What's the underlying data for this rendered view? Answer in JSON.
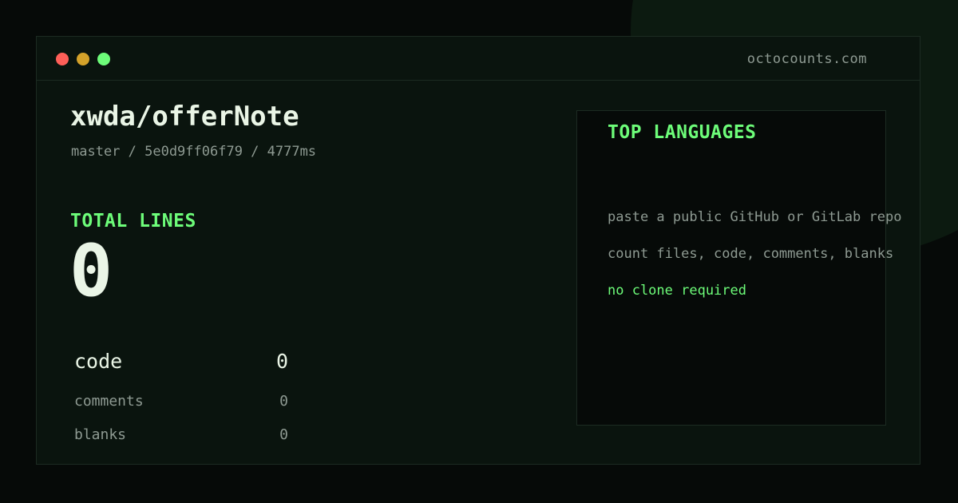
{
  "window": {
    "site": "octocounts.com",
    "controls": {
      "close_color": "#fe5f58",
      "minimize_color": "#d4a22a",
      "maximize_color": "#6dfc79"
    }
  },
  "repo": {
    "title": "xwda/offerNote",
    "meta": "master / 5e0d9ff06f79 / 4777ms"
  },
  "totals": {
    "label": "TOTAL LINES",
    "value": "0"
  },
  "stats": [
    {
      "label": "code",
      "value": "0"
    },
    {
      "label": "comments",
      "value": "0"
    },
    {
      "label": "blanks",
      "value": "0"
    }
  ],
  "languages": {
    "title": "TOP LANGUAGES",
    "hints": [
      "paste a public GitHub or GitLab repo",
      "count files, code, comments, blanks",
      "no clone required"
    ]
  },
  "colors": {
    "accent": "#6dfc79",
    "background": "#060a08",
    "panel": "#0a140e",
    "text_primary": "#eaf5e6",
    "text_muted": "#8e9a92"
  }
}
